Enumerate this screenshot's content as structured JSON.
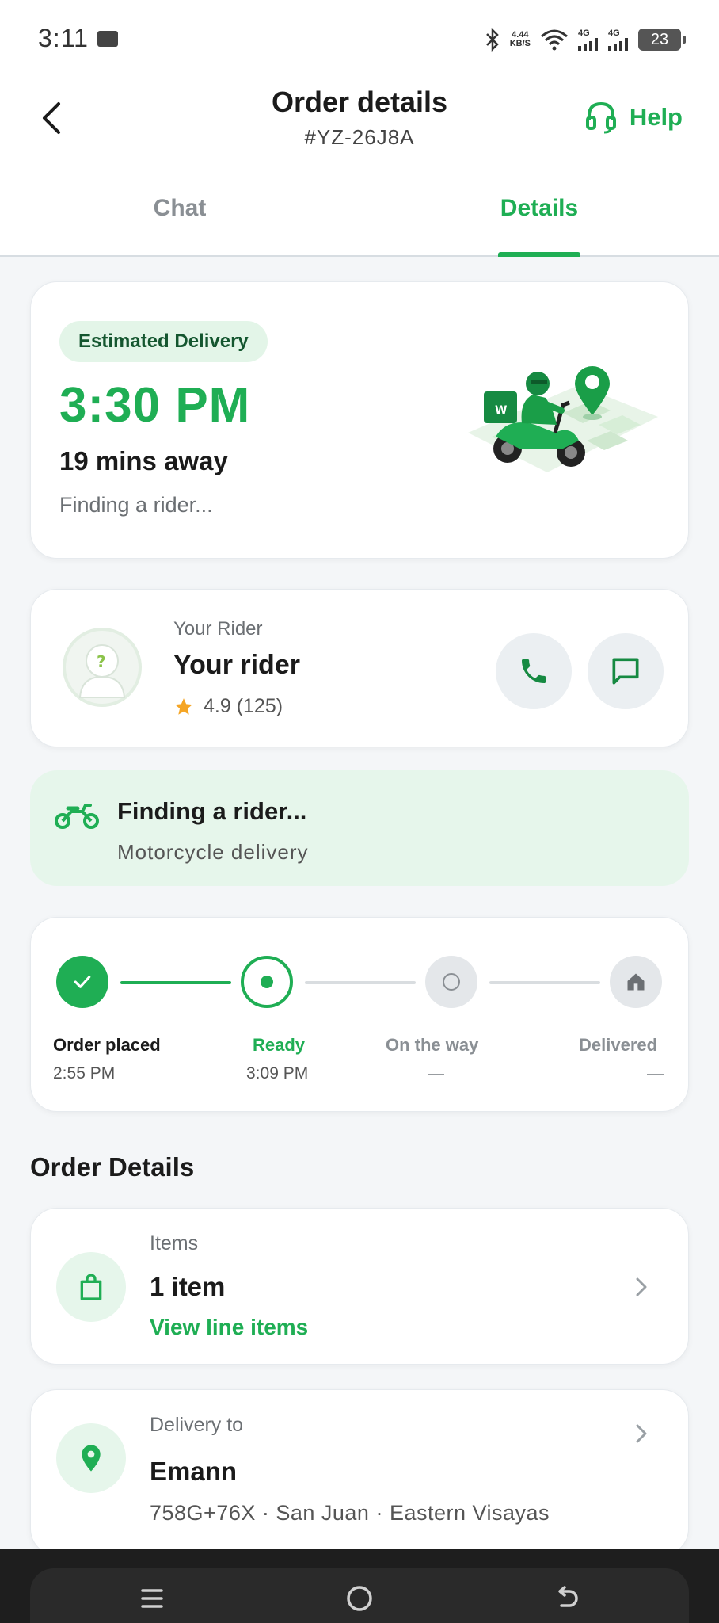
{
  "status_bar": {
    "time": "3:11",
    "net_speed_value": "4.44",
    "net_speed_unit": "KB/S",
    "sim1": "4G",
    "sim2": "4G",
    "battery": "23"
  },
  "header": {
    "title": "Order details",
    "order_id": "#YZ-26J8A",
    "help_label": "Help"
  },
  "tabs": [
    {
      "label": "Chat",
      "active": false
    },
    {
      "label": "Details",
      "active": true
    }
  ],
  "eta": {
    "badge": "Estimated Delivery",
    "time": "3:30 PM",
    "away": "19 mins away",
    "status": "Finding a rider..."
  },
  "rider": {
    "caption": "Your Rider",
    "name": "Your rider",
    "rating": "4.9 (125)"
  },
  "finding": {
    "title": "Finding a rider...",
    "subtitle": "Motorcycle delivery"
  },
  "progress": {
    "steps": [
      {
        "label": "Order placed",
        "time": "2:55 PM",
        "state": "done"
      },
      {
        "label": "Ready",
        "time": "3:09 PM",
        "state": "current"
      },
      {
        "label": "On the way",
        "time": "—",
        "state": "pending"
      },
      {
        "label": "Delivered",
        "time": "—",
        "state": "pending"
      }
    ]
  },
  "order_details": {
    "section_title": "Order Details",
    "items": {
      "label": "Items",
      "value": "1 item",
      "link": "View line items"
    },
    "delivery": {
      "label": "Delivery to",
      "name": "Emann",
      "address": "758G+76X · San Juan · Eastern Visayas"
    }
  },
  "colors": {
    "accent": "#1fae54",
    "accent_light": "#e6f6eb",
    "pending": "#d9dde0"
  }
}
